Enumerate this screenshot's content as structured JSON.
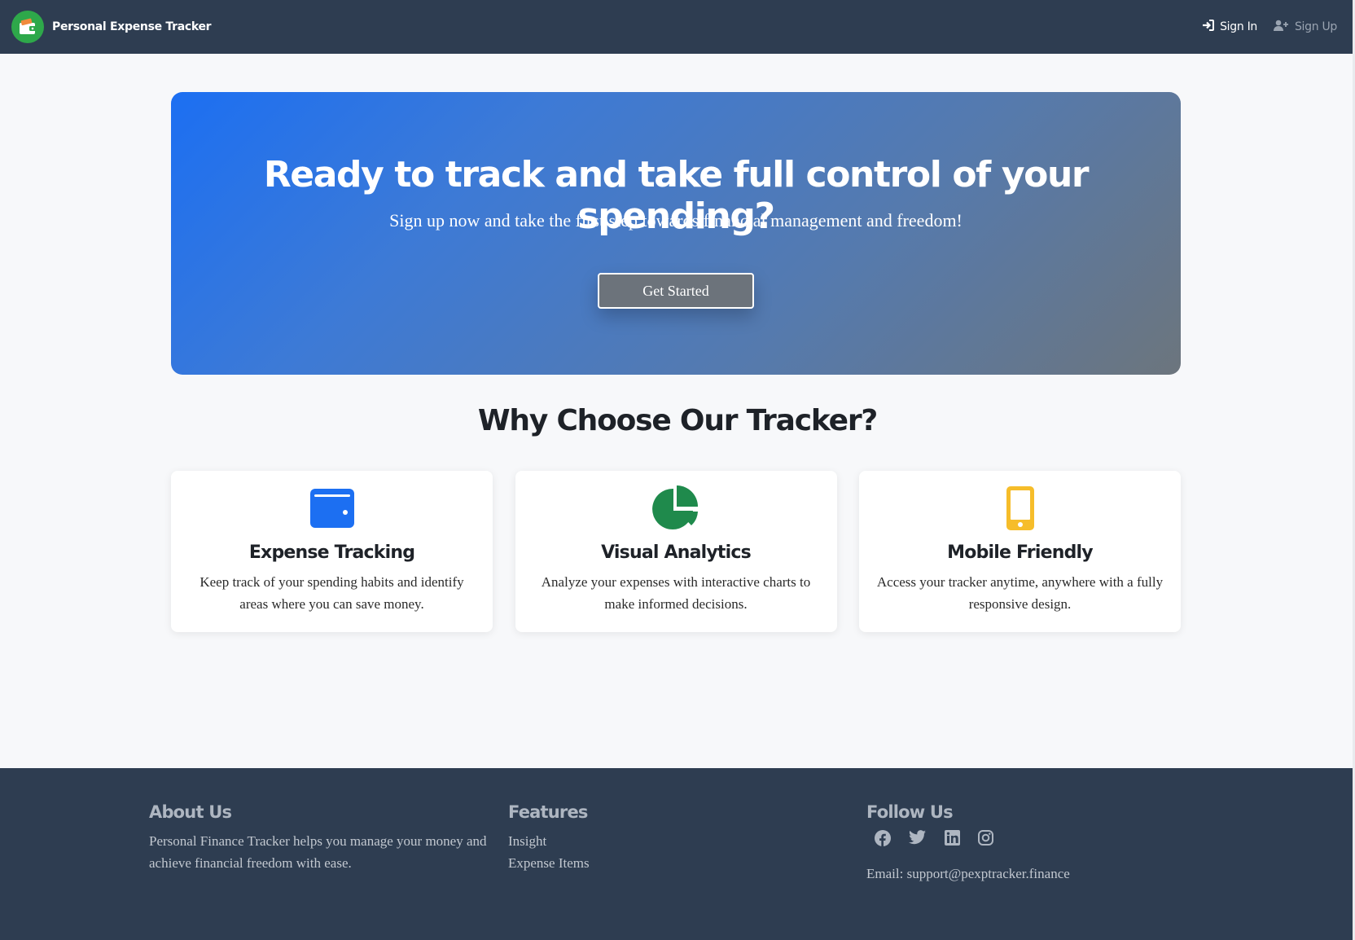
{
  "header": {
    "brand_name": "Personal Expense Tracker",
    "signin_label": "Sign In",
    "signup_label": "Sign Up"
  },
  "hero": {
    "title": "Ready to track and take full control of your spending?",
    "subtitle": "Sign up now and take the first step towards financial management and freedom!",
    "cta_label": "Get Started"
  },
  "features": {
    "title": "Why Choose Our Tracker?",
    "cards": [
      {
        "icon": "wallet-icon",
        "color": "#1c6ff2",
        "title": "Expense Tracking",
        "text": "Keep track of your spending habits and identify areas where you can save money."
      },
      {
        "icon": "pie-chart-icon",
        "color": "#1f8a4c",
        "title": "Visual Analytics",
        "text": "Analyze your expenses with interactive charts to make informed decisions."
      },
      {
        "icon": "mobile-phone-icon",
        "color": "#f6bd2a",
        "title": "Mobile Friendly",
        "text": "Access your tracker anytime, anywhere with a fully responsive design."
      }
    ]
  },
  "footer": {
    "about": {
      "title": "About Us",
      "text": "Personal Finance Tracker helps you manage your money and achieve financial freedom with ease."
    },
    "features": {
      "title": "Features",
      "links": [
        "Insight",
        "Expense Items"
      ]
    },
    "follow": {
      "title": "Follow Us",
      "social": [
        "facebook-icon",
        "twitter-icon",
        "linkedin-icon",
        "instagram-icon"
      ],
      "email": "Email: support@pexptracker.finance"
    }
  },
  "colors": {
    "navbar": "#2e3d51",
    "accent_blue": "#1c6ff2",
    "accent_green": "#1f8a4c",
    "accent_yellow": "#f6bd2a"
  }
}
